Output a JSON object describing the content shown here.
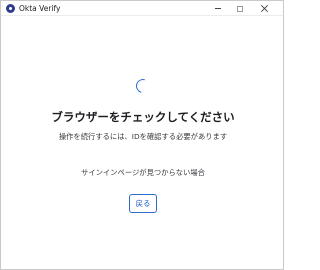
{
  "window": {
    "title": "Okta Verify",
    "app_icon": "okta-logo-icon",
    "controls": [
      "minimize-icon",
      "maximize-icon",
      "close-icon"
    ]
  },
  "main": {
    "loading_icon": "spinner-icon",
    "heading": "ブラウザーをチェックしてください",
    "subtext": "操作を続行するには、IDを確認する必要があります",
    "help_link": "サインインページが見つからない場合",
    "back_button_label": "戻る"
  },
  "colors": {
    "accent": "#2e6bd1",
    "app_icon": "#2f3b8f",
    "background": "#ffffff"
  }
}
